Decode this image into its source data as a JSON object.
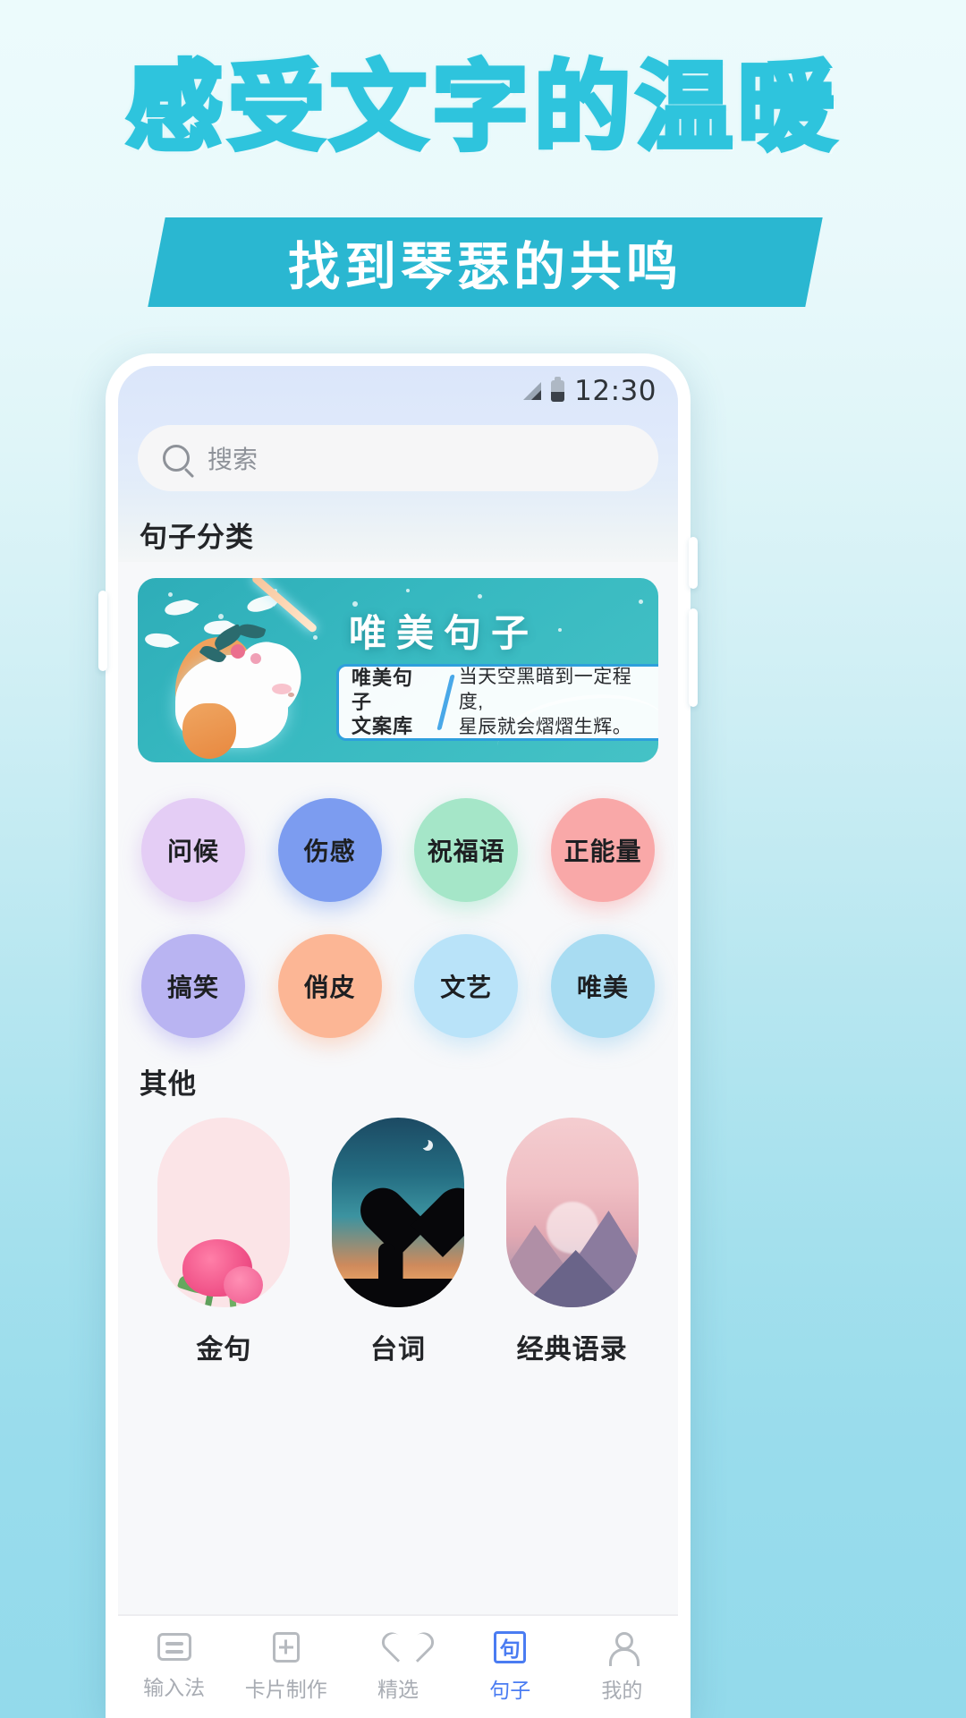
{
  "promo": {
    "title": "感受文字的温暖",
    "subtitle": "找到琴瑟的共鸣",
    "accent": "#2ec4dd",
    "ribbon_color": "#2ab7d1"
  },
  "statusbar": {
    "time": "12:30",
    "signal_icon": "signal-bars-icon",
    "battery_icon": "battery-icon"
  },
  "search": {
    "icon": "search-icon",
    "placeholder": "搜索",
    "value": ""
  },
  "sections": {
    "categories_title": "句子分类",
    "other_title": "其他"
  },
  "banner": {
    "title": "唯美句子",
    "brand": "唯美句子\n文案库",
    "quote": "当天空黑暗到一定程度,\n星辰就会熠熠生辉。",
    "bg_color": "#36b8c0",
    "box_border": "#2e9fdc"
  },
  "categories": [
    {
      "label": "问候",
      "color": "#e4cdf5"
    },
    {
      "label": "伤感",
      "color": "#7c9cf0"
    },
    {
      "label": "祝福语",
      "color": "#a5e6c8"
    },
    {
      "label": "正能量",
      "color": "#f9a8a8"
    },
    {
      "label": "搞笑",
      "color": "#b9b4f2"
    },
    {
      "label": "俏皮",
      "color": "#fcb695"
    },
    {
      "label": "文艺",
      "color": "#b9e3f9"
    },
    {
      "label": "唯美",
      "color": "#a8dcf2"
    }
  ],
  "other_cards": [
    {
      "label": "金句",
      "thumb": "pink-flower-image"
    },
    {
      "label": "台词",
      "thumb": "heart-tree-sunset-image"
    },
    {
      "label": "经典语录",
      "thumb": "pink-mountain-image"
    }
  ],
  "tabbar": {
    "active_color": "#4a7cf2",
    "inactive_color": "#a8acb3",
    "items": [
      {
        "label": "输入法",
        "icon": "keyboard-icon",
        "active": false
      },
      {
        "label": "卡片制作",
        "icon": "card-plus-icon",
        "active": false
      },
      {
        "label": "精选",
        "icon": "heart-icon",
        "active": false
      },
      {
        "label": "句子",
        "icon": "sentence-icon",
        "active": true,
        "glyph": "句"
      },
      {
        "label": "我的",
        "icon": "user-icon",
        "active": false
      }
    ]
  }
}
